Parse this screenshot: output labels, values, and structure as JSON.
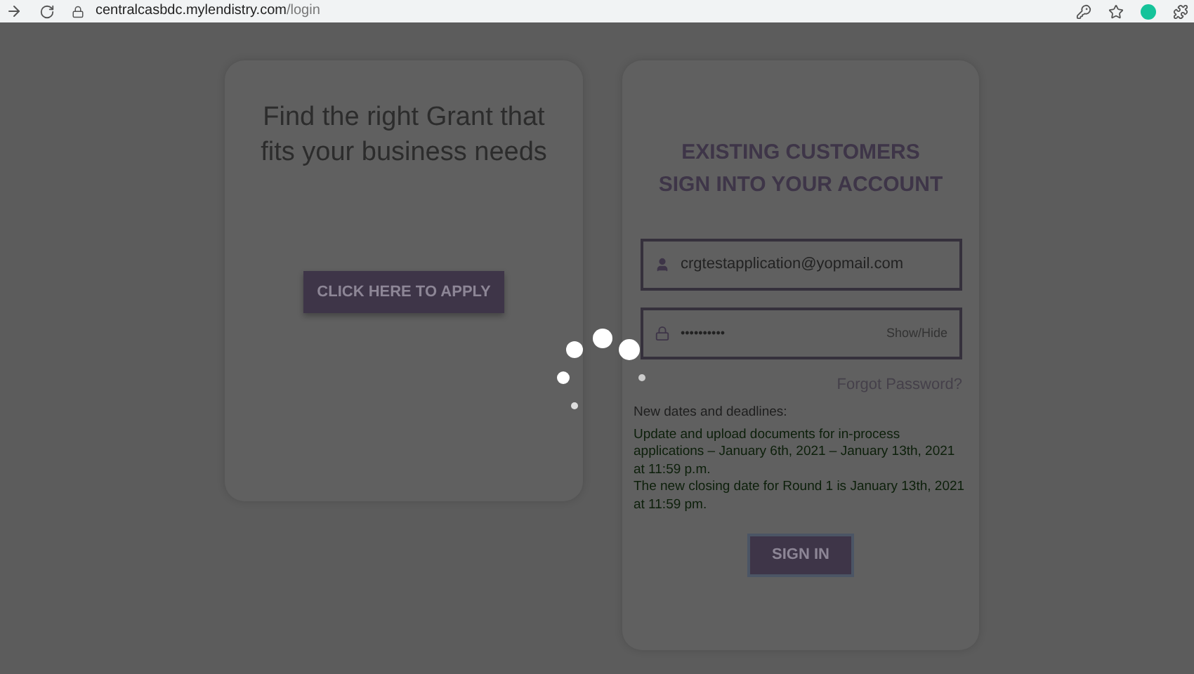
{
  "browser": {
    "domain": "centralcasbdc.mylendistry.com",
    "path": "/login"
  },
  "apply_card": {
    "heading": "Find the right Grant that fits your business needs",
    "button": "CLICK HERE TO APPLY"
  },
  "login_card": {
    "heading_lines": [
      "EXISTING CUSTOMERS",
      "SIGN INTO YOUR ACCOUNT"
    ],
    "email": {
      "value": "crgtestapplication@yopmail.com"
    },
    "password": {
      "value": "••••••••••",
      "toggle": "Show/Hide"
    },
    "forgot": "Forgot Password?",
    "notice_title": "New dates and deadlines:",
    "notices": [
      "Update and upload documents for in-process applications – January 6th, 2021 – January 13th, 2021 at 11:59 p.m.",
      "The new closing date for Round 1 is January 13th, 2021 at 11:59 pm."
    ],
    "button": "SIGN IN"
  }
}
